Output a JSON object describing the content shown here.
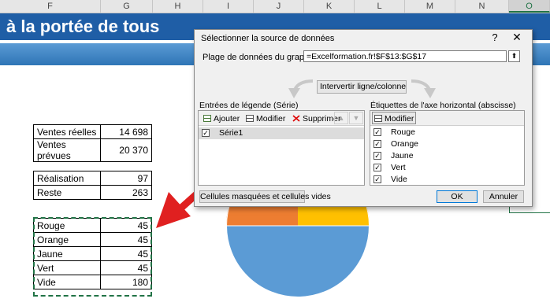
{
  "columns": {
    "headers": [
      "F",
      "G",
      "H",
      "I",
      "J",
      "K",
      "L",
      "M",
      "N",
      "O"
    ],
    "selected": "O"
  },
  "sheet": {
    "banner_title": "à la portée de tous",
    "table1": [
      {
        "label": "Ventes réelles",
        "value": "14 698"
      },
      {
        "label": "Ventes prévues",
        "value": "20 370"
      }
    ],
    "table2": [
      {
        "label": "Réalisation",
        "value": "97"
      },
      {
        "label": "Reste",
        "value": "263"
      }
    ],
    "table3": [
      {
        "label": "Rouge",
        "value": "45"
      },
      {
        "label": "Orange",
        "value": "45"
      },
      {
        "label": "Jaune",
        "value": "45"
      },
      {
        "label": "Vert",
        "value": "45"
      },
      {
        "label": "Vide",
        "value": "180"
      }
    ]
  },
  "pie_colors": {
    "main": "#5b9bd5",
    "orange": "#ed7d31",
    "yellow": "#ffc000",
    "outline": "#2e75b6"
  },
  "dialog": {
    "title": "Sélectionner la source de données",
    "help": "?",
    "close": "✕",
    "range_label": "Plage de données du graphique :",
    "range_value": "=Excelformation.fr!$F$13:$G$17",
    "range_collapse": "⬆",
    "switch_label": "Intervertir ligne/colonne",
    "legend_group": "Entrées de légende (Série)",
    "add_label": "Ajouter",
    "edit_label": "Modifier",
    "delete_label": "Supprimer",
    "up_arrow": "▲",
    "down_arrow": "▼",
    "series": [
      "Série1"
    ],
    "axis_group": "Étiquettes de l'axe horizontal (abscisse)",
    "axis_edit_label": "Modifier",
    "axis_items": [
      "Rouge",
      "Orange",
      "Jaune",
      "Vert",
      "Vide"
    ],
    "check_mark": "✓",
    "hidden_cells_label": "Cellules masquées et cellules vides",
    "ok_label": "OK",
    "cancel_label": "Annuler"
  }
}
